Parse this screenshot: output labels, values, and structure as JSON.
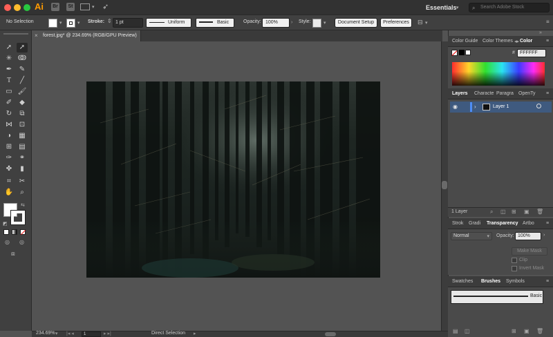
{
  "window": {
    "app_badge": "Ai",
    "bridge_badge": "Br",
    "stock_badge": "St",
    "workspace": "Essentials",
    "search_placeholder": "Search Adobe Stock"
  },
  "control_bar": {
    "selection_label": "No Selection",
    "stroke_label": "Stroke:",
    "stroke_weight": "1 pt",
    "profile": "Uniform",
    "brush": "Basic",
    "opacity_label": "Opacity:",
    "opacity_value": "100%",
    "style_label": "Style:",
    "document_setup": "Document Setup",
    "preferences": "Preferences"
  },
  "document_tab": {
    "close": "×",
    "title": "forest.jpg* @ 234.69% (RGB/GPU Preview)"
  },
  "status_bar": {
    "zoom": "234.69%",
    "artboard": "1",
    "tool": "Direct Selection"
  },
  "color_panel": {
    "tabs": [
      "Color Guide",
      "Color Themes",
      "Color"
    ],
    "hex_label": "#",
    "hex_value": "FFFFFF"
  },
  "layers_panel": {
    "tabs": [
      "Layers",
      "Characte",
      "Paragra",
      "OpenTy"
    ],
    "layer_name": "Layer 1",
    "count": "1 Layer"
  },
  "transparency_panel": {
    "tabs": [
      "Strok",
      "Gradi",
      "Transparency",
      "Artbo"
    ],
    "blend_mode": "Normal",
    "opacity_label": "Opacity:",
    "opacity_value": "100%",
    "make_mask": "Make Mask",
    "clip": "Clip",
    "invert_mask": "Invert Mask"
  },
  "brushes_panel": {
    "tabs": [
      "Swatches",
      "Brushes",
      "Symbols"
    ],
    "brush_name": "Basic"
  },
  "colors": {
    "close": "#ff5f57",
    "minimize": "#febc2e",
    "zoom": "#28c840",
    "ai_orange": "#ff9a00",
    "layer_highlight": "#3f5a7f"
  }
}
